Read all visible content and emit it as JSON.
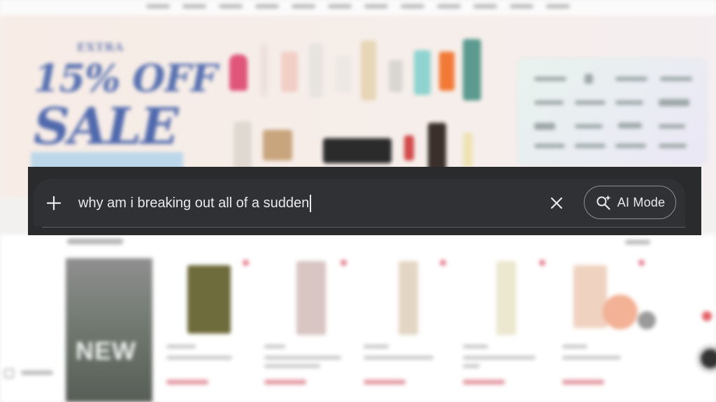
{
  "search": {
    "query": "why am i breaking out all of a sudden",
    "ai_mode_label": "AI Mode"
  },
  "background": {
    "promo_extra": "EXTRA",
    "promo_percent": "15% OFF",
    "promo_sale": "SALE",
    "new_badge": "NEW"
  },
  "colors": {
    "search_surface": "#303134",
    "overlay_band": "#2a2b2c",
    "text_primary": "#e8eaed",
    "outline": "#8e9195",
    "sale_blue": "#5670b0"
  },
  "icons": {
    "add": "plus-icon",
    "clear": "close-icon",
    "ai_mode": "magnifier-sparkle-icon"
  }
}
